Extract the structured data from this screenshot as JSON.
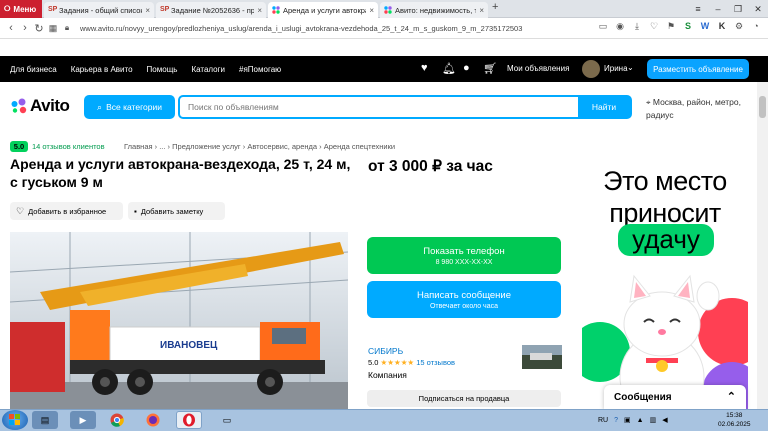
{
  "browser": {
    "menu_label": "Меню",
    "tabs": [
      {
        "title": "Задания - общий список",
        "fav": "SP"
      },
      {
        "title": "Задание №2052636 - пр",
        "fav": "SP"
      },
      {
        "title": "Аренда и услуги автокра",
        "fav": "av"
      },
      {
        "title": "Авито: недвижимость, тр",
        "fav": "av"
      }
    ],
    "new_tab": "+",
    "url": "www.avito.ru/novyy_urengoy/predlozheniya_uslug/arenda_i_uslugi_avtokrana-vezdehoda_25_t_24_m_s_guskom_9_m_2735172503"
  },
  "topnav": {
    "links": [
      "Для бизнеса",
      "Карьера в Авито",
      "Помощь",
      "Каталоги",
      "#яПомогаю"
    ],
    "my_ads": "Мои объявления",
    "user": "Ирина",
    "place_ad": "Разместить объявление"
  },
  "header": {
    "logo": "Avito",
    "categories": "Все категории",
    "search_placeholder": "Поиск по объявлениям",
    "find": "Найти",
    "geo": "Москва, район, метро, радиус"
  },
  "listing": {
    "rating": "5.0",
    "reviews": "14 отзывов клиентов",
    "breadcrumbs": "Главная  ›  ...  ›  Предложение услуг  ›  Автосервис, аренда  ›  Аренда спецтехники",
    "title": "Аренда и услуги автокрана-вездехода, 25 т, 24 м, с гуськом 9 м",
    "price": "от 3 000 ₽ за час",
    "favorite": "Добавить в избранное",
    "note": "Добавить заметку",
    "photo_brand": "ИВАНОВЕЦ"
  },
  "actions": {
    "show_phone": "Показать телефон",
    "phone_mask": "8 980 XXX-XX-XX",
    "write": "Написать сообщение",
    "reply_time": "Отвечает около часа",
    "subscribe": "Подписаться на продавца"
  },
  "seller": {
    "name": "СИБИРЬ",
    "rating": "5.0",
    "stars": "★★★★★",
    "reviews": "15 отзывов",
    "type": "Компания"
  },
  "ad": {
    "line1": "Это место",
    "line2": "приносит",
    "line3": "удачу"
  },
  "messages": {
    "label": "Сообщения"
  },
  "taskbar": {
    "lang": "RU",
    "time": "15:38",
    "date": "02.06.2025"
  },
  "colors": {
    "accent": "#00aaff",
    "green": "#00c853",
    "opera": "#cc1f2f"
  }
}
